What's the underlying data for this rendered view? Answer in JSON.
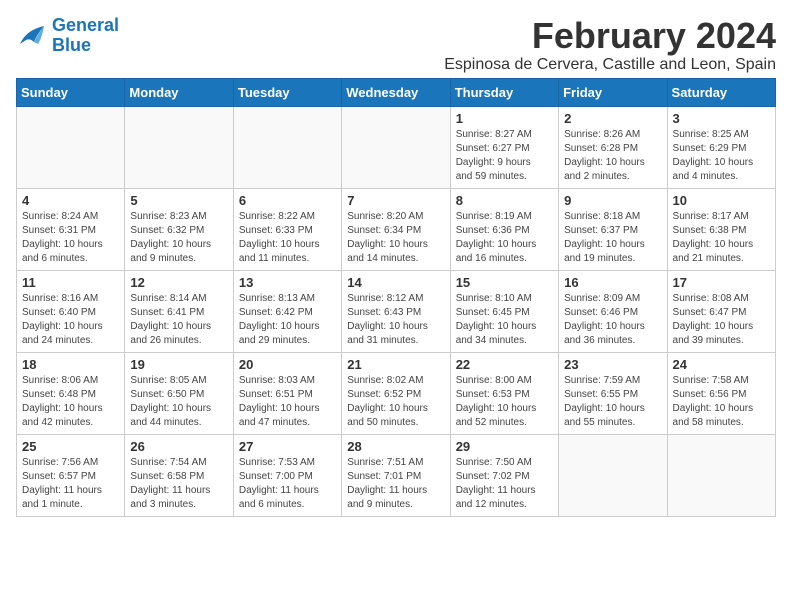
{
  "logo": {
    "line1": "General",
    "line2": "Blue"
  },
  "title": "February 2024",
  "location": "Espinosa de Cervera, Castille and Leon, Spain",
  "days_header": [
    "Sunday",
    "Monday",
    "Tuesday",
    "Wednesday",
    "Thursday",
    "Friday",
    "Saturday"
  ],
  "weeks": [
    [
      {
        "day": "",
        "info": ""
      },
      {
        "day": "",
        "info": ""
      },
      {
        "day": "",
        "info": ""
      },
      {
        "day": "",
        "info": ""
      },
      {
        "day": "1",
        "info": "Sunrise: 8:27 AM\nSunset: 6:27 PM\nDaylight: 9 hours\nand 59 minutes."
      },
      {
        "day": "2",
        "info": "Sunrise: 8:26 AM\nSunset: 6:28 PM\nDaylight: 10 hours\nand 2 minutes."
      },
      {
        "day": "3",
        "info": "Sunrise: 8:25 AM\nSunset: 6:29 PM\nDaylight: 10 hours\nand 4 minutes."
      }
    ],
    [
      {
        "day": "4",
        "info": "Sunrise: 8:24 AM\nSunset: 6:31 PM\nDaylight: 10 hours\nand 6 minutes."
      },
      {
        "day": "5",
        "info": "Sunrise: 8:23 AM\nSunset: 6:32 PM\nDaylight: 10 hours\nand 9 minutes."
      },
      {
        "day": "6",
        "info": "Sunrise: 8:22 AM\nSunset: 6:33 PM\nDaylight: 10 hours\nand 11 minutes."
      },
      {
        "day": "7",
        "info": "Sunrise: 8:20 AM\nSunset: 6:34 PM\nDaylight: 10 hours\nand 14 minutes."
      },
      {
        "day": "8",
        "info": "Sunrise: 8:19 AM\nSunset: 6:36 PM\nDaylight: 10 hours\nand 16 minutes."
      },
      {
        "day": "9",
        "info": "Sunrise: 8:18 AM\nSunset: 6:37 PM\nDaylight: 10 hours\nand 19 minutes."
      },
      {
        "day": "10",
        "info": "Sunrise: 8:17 AM\nSunset: 6:38 PM\nDaylight: 10 hours\nand 21 minutes."
      }
    ],
    [
      {
        "day": "11",
        "info": "Sunrise: 8:16 AM\nSunset: 6:40 PM\nDaylight: 10 hours\nand 24 minutes."
      },
      {
        "day": "12",
        "info": "Sunrise: 8:14 AM\nSunset: 6:41 PM\nDaylight: 10 hours\nand 26 minutes."
      },
      {
        "day": "13",
        "info": "Sunrise: 8:13 AM\nSunset: 6:42 PM\nDaylight: 10 hours\nand 29 minutes."
      },
      {
        "day": "14",
        "info": "Sunrise: 8:12 AM\nSunset: 6:43 PM\nDaylight: 10 hours\nand 31 minutes."
      },
      {
        "day": "15",
        "info": "Sunrise: 8:10 AM\nSunset: 6:45 PM\nDaylight: 10 hours\nand 34 minutes."
      },
      {
        "day": "16",
        "info": "Sunrise: 8:09 AM\nSunset: 6:46 PM\nDaylight: 10 hours\nand 36 minutes."
      },
      {
        "day": "17",
        "info": "Sunrise: 8:08 AM\nSunset: 6:47 PM\nDaylight: 10 hours\nand 39 minutes."
      }
    ],
    [
      {
        "day": "18",
        "info": "Sunrise: 8:06 AM\nSunset: 6:48 PM\nDaylight: 10 hours\nand 42 minutes."
      },
      {
        "day": "19",
        "info": "Sunrise: 8:05 AM\nSunset: 6:50 PM\nDaylight: 10 hours\nand 44 minutes."
      },
      {
        "day": "20",
        "info": "Sunrise: 8:03 AM\nSunset: 6:51 PM\nDaylight: 10 hours\nand 47 minutes."
      },
      {
        "day": "21",
        "info": "Sunrise: 8:02 AM\nSunset: 6:52 PM\nDaylight: 10 hours\nand 50 minutes."
      },
      {
        "day": "22",
        "info": "Sunrise: 8:00 AM\nSunset: 6:53 PM\nDaylight: 10 hours\nand 52 minutes."
      },
      {
        "day": "23",
        "info": "Sunrise: 7:59 AM\nSunset: 6:55 PM\nDaylight: 10 hours\nand 55 minutes."
      },
      {
        "day": "24",
        "info": "Sunrise: 7:58 AM\nSunset: 6:56 PM\nDaylight: 10 hours\nand 58 minutes."
      }
    ],
    [
      {
        "day": "25",
        "info": "Sunrise: 7:56 AM\nSunset: 6:57 PM\nDaylight: 11 hours\nand 1 minute."
      },
      {
        "day": "26",
        "info": "Sunrise: 7:54 AM\nSunset: 6:58 PM\nDaylight: 11 hours\nand 3 minutes."
      },
      {
        "day": "27",
        "info": "Sunrise: 7:53 AM\nSunset: 7:00 PM\nDaylight: 11 hours\nand 6 minutes."
      },
      {
        "day": "28",
        "info": "Sunrise: 7:51 AM\nSunset: 7:01 PM\nDaylight: 11 hours\nand 9 minutes."
      },
      {
        "day": "29",
        "info": "Sunrise: 7:50 AM\nSunset: 7:02 PM\nDaylight: 11 hours\nand 12 minutes."
      },
      {
        "day": "",
        "info": ""
      },
      {
        "day": "",
        "info": ""
      }
    ]
  ]
}
